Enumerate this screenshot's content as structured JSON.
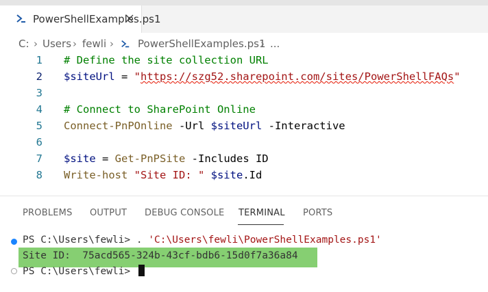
{
  "tab": {
    "filename": "PowerShellExamples.ps1"
  },
  "breadcrumb": {
    "parts": [
      "C:",
      "Users",
      "fewli",
      "PowerShellExamples.ps1",
      "..."
    ]
  },
  "editor": {
    "lines": [
      {
        "number": "1",
        "text": "# Define the site collection URL"
      },
      {
        "number": "2",
        "var": "$siteUrl",
        "op": " = ",
        "str_quote_open": "\"",
        "str_url": "https://szg52.sharepoint.com/sites/PowerShellFAQs",
        "str_quote_close": "\""
      },
      {
        "number": "3"
      },
      {
        "number": "4",
        "text": "# Connect to SharePoint Online"
      },
      {
        "number": "5",
        "cmd": "Connect-PnPOnline",
        "param1": " -Url ",
        "var": "$siteUrl",
        "param2": " -Interactive"
      },
      {
        "number": "6"
      },
      {
        "number": "7",
        "var": "$site",
        "op": " = ",
        "cmd": "Get-PnPSite",
        "param": " -Includes ID"
      },
      {
        "number": "8",
        "cmd": "Write-host",
        "str": " \"Site ID: \"",
        "var": " $site",
        "prop": ".Id"
      }
    ]
  },
  "panel": {
    "tabs": [
      "PROBLEMS",
      "OUTPUT",
      "DEBUG CONSOLE",
      "TERMINAL",
      "PORTS"
    ],
    "active_tab": "TERMINAL"
  },
  "terminal": {
    "line1_prompt": "PS C:\\Users\\fewli> . ",
    "line1_path": "'C:\\Users\\fewli\\PowerShellExamples.ps1'",
    "line2": "Site ID:  75acd565-324b-43cf-bdb6-15d0f7a36a84",
    "line3_prompt": "PS C:\\Users\\fewli> "
  },
  "colors": {
    "highlight": "#86cf72",
    "accent": "#1a85ff"
  }
}
